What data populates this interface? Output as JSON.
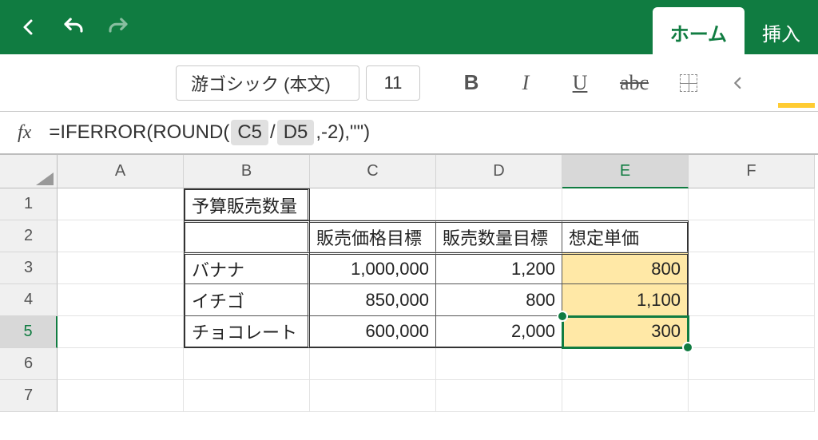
{
  "toolbar": {
    "back_icon": "chevron-left",
    "undo_icon": "undo",
    "redo_icon": "redo"
  },
  "tabs": {
    "active": "ホーム",
    "next": "挿入"
  },
  "ribbon": {
    "font_name": "游ゴシック (本文)",
    "font_size": "11",
    "bold": "B",
    "italic": "I",
    "underline": "U",
    "strike": "abc"
  },
  "formula": {
    "fx_label": "fx",
    "prefix": "=IFERROR(ROUND(",
    "ref1": "C5",
    "slash": " / ",
    "ref2": "D5",
    "suffix": ",-2),\"\")"
  },
  "columns": [
    "A",
    "B",
    "C",
    "D",
    "E",
    "F"
  ],
  "rows": [
    "1",
    "2",
    "3",
    "4",
    "5",
    "6",
    "7"
  ],
  "cells": {
    "B1": "予算販売数量",
    "C2": "販売価格目標",
    "D2": "販売数量目標",
    "E2": "想定単価",
    "B3": "バナナ",
    "C3": "1,000,000",
    "D3": "1,200",
    "E3": "800",
    "B4": "イチゴ",
    "C4": "850,000",
    "D4": "800",
    "E4": "1,100",
    "B5": "チョコレート",
    "C5": "600,000",
    "D5": "2,000",
    "E5": "300"
  },
  "active_cell": "E5",
  "active_row": "5",
  "active_col": "E",
  "chart_data": {
    "type": "table",
    "title": "予算販売数量",
    "columns": [
      "",
      "販売価格目標",
      "販売数量目標",
      "想定単価"
    ],
    "rows": [
      {
        "name": "バナナ",
        "price_target": 1000000,
        "qty_target": 1200,
        "unit_price": 800
      },
      {
        "name": "イチゴ",
        "price_target": 850000,
        "qty_target": 800,
        "unit_price": 1100
      },
      {
        "name": "チョコレート",
        "price_target": 600000,
        "qty_target": 2000,
        "unit_price": 300
      }
    ],
    "formula_for_unit_price": "=IFERROR(ROUND(C/D,-2),\"\")"
  }
}
